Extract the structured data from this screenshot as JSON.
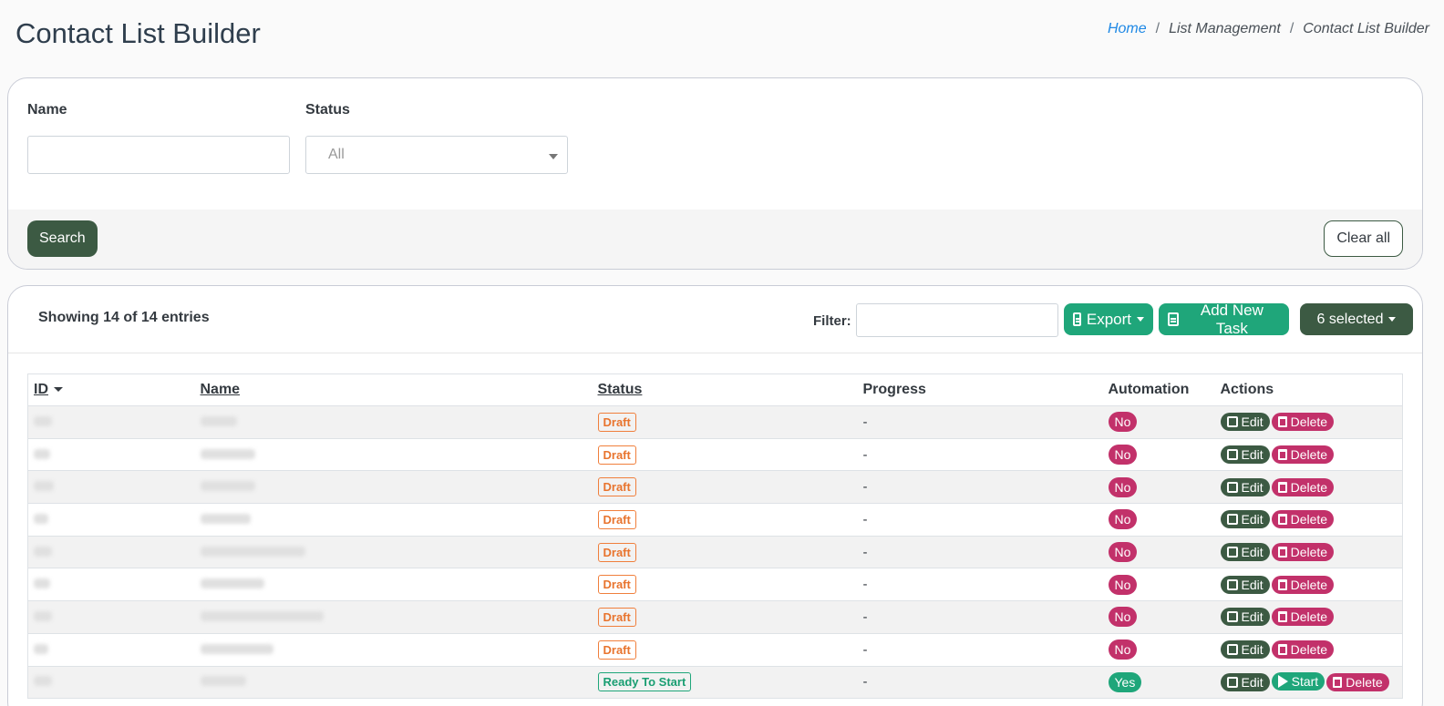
{
  "header": {
    "title": "Contact List Builder",
    "breadcrumb": [
      "Home",
      "List Management",
      "Contact List Builder"
    ]
  },
  "filters": {
    "name_label": "Name",
    "name_value": "",
    "status_label": "Status",
    "status_value": "All",
    "search_label": "Search",
    "clear_label": "Clear all"
  },
  "toolbar": {
    "entries_text": "Showing 14 of 14 entries",
    "filter_label": "Filter:",
    "filter_value": "",
    "export_label": "Export",
    "add_label": "Add New Task",
    "selected_label": "6 selected"
  },
  "table": {
    "columns": [
      "ID",
      "Name",
      "Status",
      "Progress",
      "Automation",
      "Actions"
    ],
    "rows": [
      {
        "status": "Draft",
        "progress": "-",
        "automation": "No",
        "actions": [
          "Edit",
          "Delete"
        ]
      },
      {
        "status": "Draft",
        "progress": "-",
        "automation": "No",
        "actions": [
          "Edit",
          "Delete"
        ]
      },
      {
        "status": "Draft",
        "progress": "-",
        "automation": "No",
        "actions": [
          "Edit",
          "Delete"
        ]
      },
      {
        "status": "Draft",
        "progress": "-",
        "automation": "No",
        "actions": [
          "Edit",
          "Delete"
        ]
      },
      {
        "status": "Draft",
        "progress": "-",
        "automation": "No",
        "actions": [
          "Edit",
          "Delete"
        ]
      },
      {
        "status": "Draft",
        "progress": "-",
        "automation": "No",
        "actions": [
          "Edit",
          "Delete"
        ]
      },
      {
        "status": "Draft",
        "progress": "-",
        "automation": "No",
        "actions": [
          "Edit",
          "Delete"
        ]
      },
      {
        "status": "Draft",
        "progress": "-",
        "automation": "No",
        "actions": [
          "Edit",
          "Delete"
        ]
      },
      {
        "status": "Ready To Start",
        "progress": "-",
        "automation": "Yes",
        "actions": [
          "Edit",
          "Start",
          "Delete"
        ]
      }
    ]
  },
  "colors": {
    "primary_dark": "#3c5a43",
    "accent_green": "#1fa67a",
    "draft_orange": "#e8742e",
    "danger_pink": "#c2316a",
    "link_blue": "#1e88e5"
  }
}
